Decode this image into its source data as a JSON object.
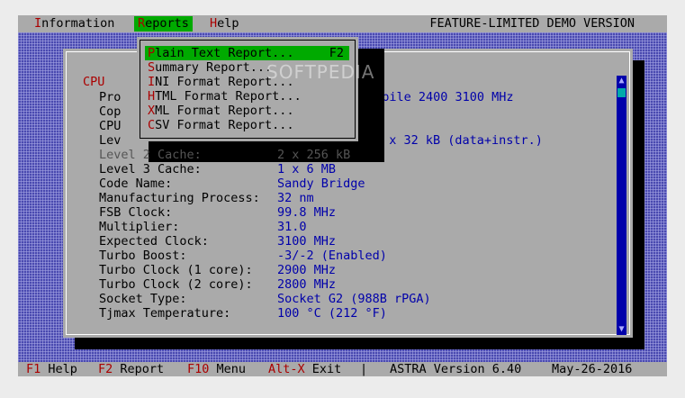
{
  "menubar": {
    "items": [
      {
        "hot": "I",
        "rest": "nformation"
      },
      {
        "hot": "R",
        "rest": "eports"
      },
      {
        "hot": "H",
        "rest": "elp"
      }
    ],
    "demo_label": "FEATURE-LIMITED DEMO VERSION"
  },
  "cpu": {
    "title": "CPU",
    "rows": [
      {
        "label": "Pro",
        "value": "Mobile 2400 3100 MHz"
      },
      {
        "label": "Cop",
        "value": ""
      },
      {
        "label": "CPU",
        "value": ""
      },
      {
        "label": "Lev",
        "value": "2 x 32 kB (data+instr.)"
      },
      {
        "label": "Level 2 Cache:",
        "value": "2 x 256 kB"
      },
      {
        "label": "Level 3 Cache:",
        "value": "1 x 6 MB"
      },
      {
        "label": "Code Name:",
        "value": "Sandy Bridge"
      },
      {
        "label": "Manufacturing Process:",
        "value": "32 nm"
      },
      {
        "label": "FSB Clock:",
        "value": "99.8 MHz"
      },
      {
        "label": "Multiplier:",
        "value": "31.0"
      },
      {
        "label": "Expected Clock:",
        "value": "3100 MHz"
      },
      {
        "label": "Turbo Boost:",
        "value": "-3/-2 (Enabled)"
      },
      {
        "label": "Turbo Clock (1 core):",
        "value": "2900 MHz"
      },
      {
        "label": "Turbo Clock (2 core):",
        "value": "2800 MHz"
      },
      {
        "label": "Socket Type:",
        "value": "Socket G2 (988B rPGA)"
      },
      {
        "label": "Tjmax Temperature:",
        "value": "100 °C (212 °F)"
      }
    ]
  },
  "reports_menu": {
    "items": [
      {
        "hot": "P",
        "rest": "lain Text Report...",
        "shortcut": "F2",
        "selected": true
      },
      {
        "hot": "S",
        "rest": "ummary Report...",
        "shortcut": "",
        "selected": false
      },
      {
        "hot": "I",
        "rest": "NI Format Report...",
        "shortcut": "",
        "selected": false
      },
      {
        "hot": "H",
        "rest": "TML Format Report...",
        "shortcut": "",
        "selected": false
      },
      {
        "hot": "X",
        "rest": "ML Format Report...",
        "shortcut": "",
        "selected": false
      },
      {
        "hot": "C",
        "rest": "SV Format Report...",
        "shortcut": "",
        "selected": false
      }
    ]
  },
  "statusbar": {
    "f1_key": "F1",
    "f1_label": " Help",
    "f2_key": "F2",
    "f2_label": " Report",
    "f10_key": "F10",
    "f10_label": " Menu",
    "altx_key": "Alt-X",
    "altx_label": " Exit",
    "separator": "|",
    "version": "ASTRA Version 6.40",
    "date": "May-26-2016"
  },
  "watermark": "SOFTPEDIA",
  "icons": {
    "scroll_up": "triangle-up",
    "scroll_down": "triangle-down"
  },
  "colors": {
    "screen_blue": "#4a4ab0",
    "panel_gray": "#aaaaaa",
    "value_blue": "#0000aa",
    "hotkey_red": "#aa0000",
    "highlight_green": "#00aa00"
  }
}
